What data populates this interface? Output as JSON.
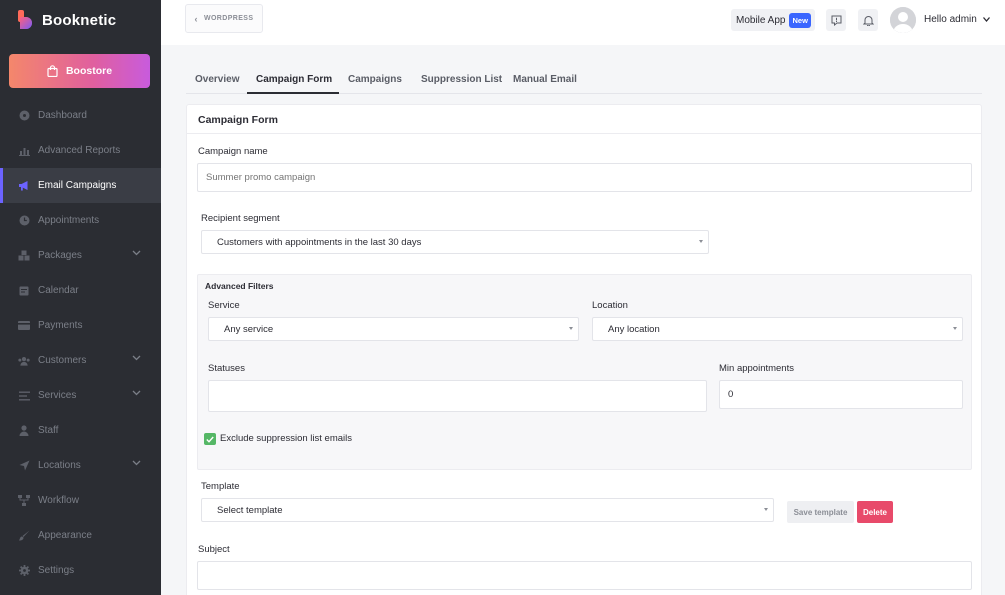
{
  "app": {
    "name": "Booknetic"
  },
  "sidebar": {
    "boostore_label": "Boostore",
    "items": [
      {
        "label": "Dashboard",
        "icon": "dashboard-icon"
      },
      {
        "label": "Advanced Reports",
        "icon": "chart-icon"
      },
      {
        "label": "Email Campaigns",
        "icon": "megaphone-icon",
        "active": true
      },
      {
        "label": "Appointments",
        "icon": "clock-icon"
      },
      {
        "label": "Packages",
        "icon": "packages-icon",
        "expandable": true
      },
      {
        "label": "Calendar",
        "icon": "calendar-icon"
      },
      {
        "label": "Payments",
        "icon": "credit-card-icon"
      },
      {
        "label": "Customers",
        "icon": "users-icon",
        "expandable": true
      },
      {
        "label": "Services",
        "icon": "list-icon",
        "expandable": true
      },
      {
        "label": "Staff",
        "icon": "user-icon"
      },
      {
        "label": "Locations",
        "icon": "location-arrow-icon",
        "expandable": true
      },
      {
        "label": "Workflow",
        "icon": "workflow-icon"
      },
      {
        "label": "Appearance",
        "icon": "brush-icon"
      },
      {
        "label": "Settings",
        "icon": "gear-icon"
      }
    ]
  },
  "header": {
    "back_label": "WORDPRESS",
    "mobile_app_label": "Mobile App",
    "new_badge": "New",
    "user_greeting": "Hello admin"
  },
  "tabs": [
    {
      "label": "Overview"
    },
    {
      "label": "Campaign Form",
      "active": true
    },
    {
      "label": "Campaigns"
    },
    {
      "label": "Suppression List"
    },
    {
      "label": "Manual Email"
    }
  ],
  "form": {
    "title": "Campaign Form",
    "campaign_name": {
      "label": "Campaign name",
      "placeholder": "Summer promo campaign",
      "value": ""
    },
    "recipient_segment": {
      "label": "Recipient segment",
      "value": "Customers with appointments in the last 30 days"
    },
    "advanced_filters": {
      "title": "Advanced Filters",
      "service": {
        "label": "Service",
        "value": "Any service"
      },
      "location": {
        "label": "Location",
        "value": "Any location"
      },
      "statuses": {
        "label": "Statuses",
        "value": ""
      },
      "min_appointments": {
        "label": "Min appointments",
        "value": "0"
      },
      "exclude_suppression": {
        "label": "Exclude suppression list emails",
        "checked": true
      }
    },
    "template": {
      "label": "Template",
      "value": "Select template",
      "save_label": "Save template",
      "delete_label": "Delete"
    },
    "subject": {
      "label": "Subject",
      "value": ""
    }
  },
  "colors": {
    "sidebar_bg": "#2b2d33",
    "accent": "#6c63ff",
    "delete": "#e84a6a",
    "checkbox": "#55b766",
    "new_badge": "#3a66ff"
  }
}
